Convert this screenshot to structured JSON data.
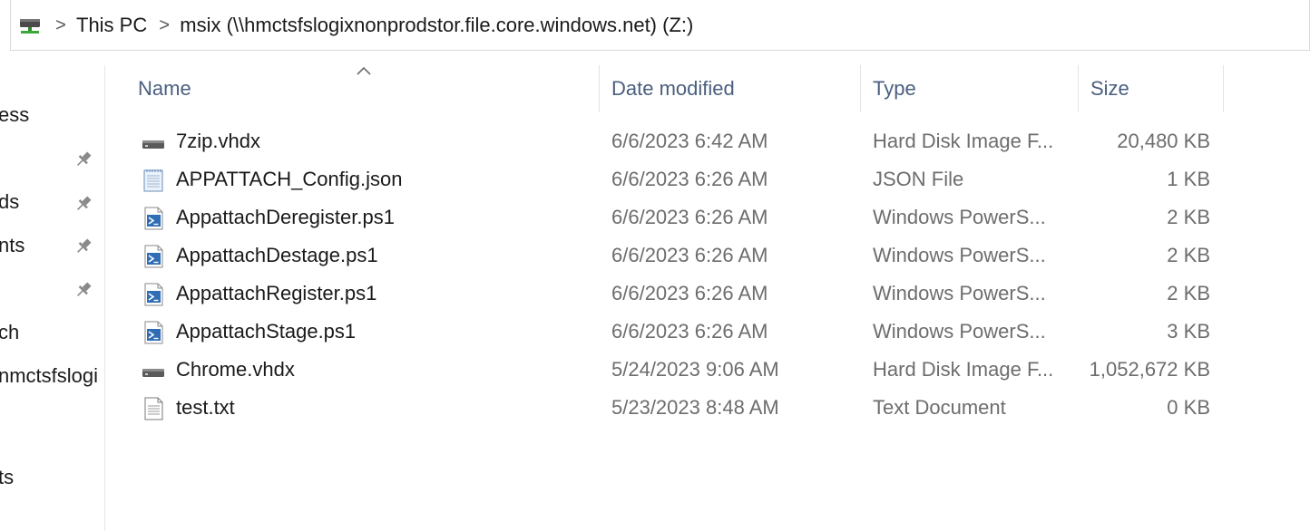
{
  "address_bar": {
    "crumbs": [
      "This PC",
      "msix (\\\\hmctsfslogixnonprodstor.file.core.windows.net) (Z:)"
    ],
    "separator": ">"
  },
  "nav_pane": {
    "items": [
      "ess",
      "ds",
      "nts",
      "ch",
      "nmctsfslogi",
      "ts"
    ]
  },
  "columns": {
    "name": "Name",
    "date": "Date modified",
    "type": "Type",
    "size": "Size"
  },
  "files": [
    {
      "name": "7zip.vhdx",
      "date": "6/6/2023 6:42 AM",
      "type": "Hard Disk Image F...",
      "size": "20,480 KB",
      "icon": "disk-image-icon"
    },
    {
      "name": "APPATTACH_Config.json",
      "date": "6/6/2023 6:26 AM",
      "type": "JSON File",
      "size": "1 KB",
      "icon": "notepad-file-icon"
    },
    {
      "name": "AppattachDeregister.ps1",
      "date": "6/6/2023 6:26 AM",
      "type": "Windows PowerS...",
      "size": "2 KB",
      "icon": "powershell-script-icon"
    },
    {
      "name": "AppattachDestage.ps1",
      "date": "6/6/2023 6:26 AM",
      "type": "Windows PowerS...",
      "size": "2 KB",
      "icon": "powershell-script-icon"
    },
    {
      "name": "AppattachRegister.ps1",
      "date": "6/6/2023 6:26 AM",
      "type": "Windows PowerS...",
      "size": "2 KB",
      "icon": "powershell-script-icon"
    },
    {
      "name": "AppattachStage.ps1",
      "date": "6/6/2023 6:26 AM",
      "type": "Windows PowerS...",
      "size": "3 KB",
      "icon": "powershell-script-icon"
    },
    {
      "name": "Chrome.vhdx",
      "date": "5/24/2023 9:06 AM",
      "type": "Hard Disk Image F...",
      "size": "1,052,672 KB",
      "icon": "disk-image-icon"
    },
    {
      "name": "test.txt",
      "date": "5/23/2023 8:48 AM",
      "type": "Text Document",
      "size": "0 KB",
      "icon": "text-document-icon"
    }
  ],
  "colors": {
    "header_text": "#4a5f7f",
    "secondary_text": "#6d6d6d",
    "script_icon_blue": "#2f6db5"
  }
}
